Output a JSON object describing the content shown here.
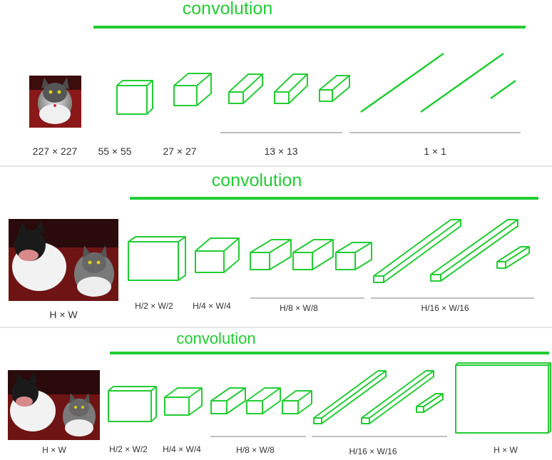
{
  "colors": {
    "accent": "#22cc33",
    "rule": "#999999",
    "text": "#333333"
  },
  "panels": [
    {
      "title": "convolution",
      "labels": [
        "227 × 227",
        "55 × 55",
        "27 × 27",
        "13 × 13",
        "1 × 1"
      ]
    },
    {
      "title": "convolution",
      "labels": [
        "H × W",
        "H/2 × W/2",
        "H/4 × W/4",
        "H/8 × W/8",
        "H/16 × W/16"
      ]
    },
    {
      "title": "convolution",
      "labels": [
        "H × W",
        "H/2 × W/2",
        "H/4 × W/4",
        "H/8 × W/8",
        "H/16 × W/16",
        "H × W"
      ]
    }
  ]
}
